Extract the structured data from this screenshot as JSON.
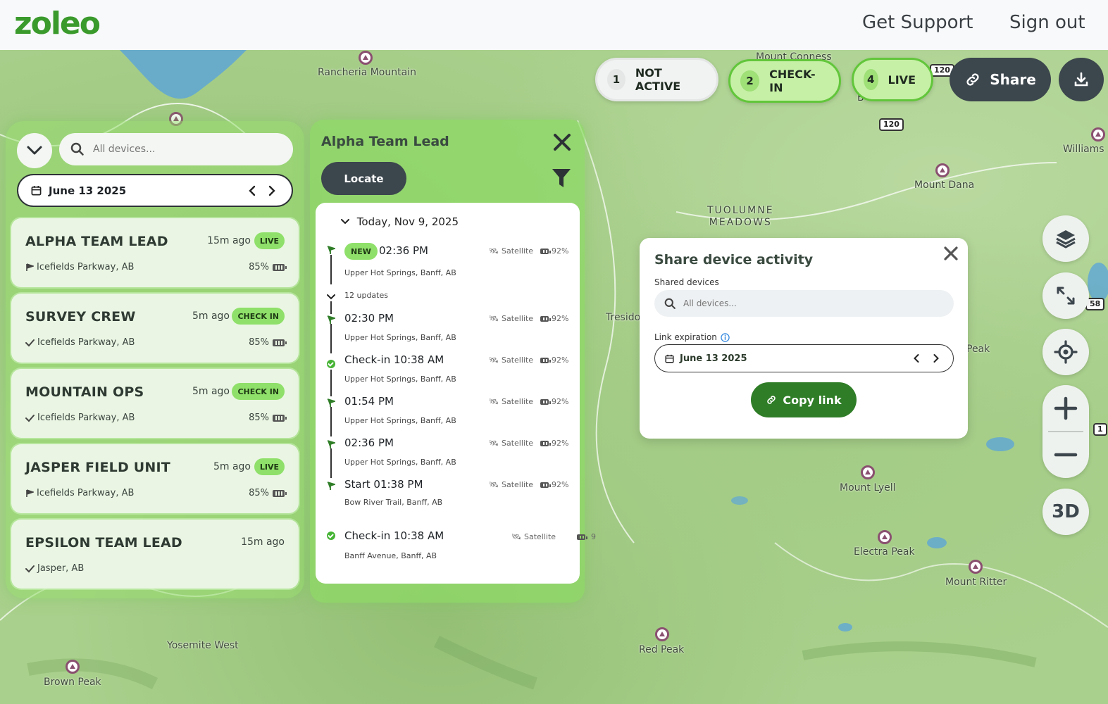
{
  "header": {
    "logo": "zoleo",
    "links": [
      "Get Support",
      "Sign out"
    ]
  },
  "status_pills": [
    {
      "count": "1",
      "label": "NOT ACTIVE",
      "variant": "inactive"
    },
    {
      "count": "2",
      "label": "CHECK-IN",
      "variant": "green"
    },
    {
      "count": "4",
      "label": "LIVE",
      "variant": "green"
    }
  ],
  "share_label": "Share",
  "sidebar": {
    "search_placeholder": "All devices...",
    "date": "June 13 2025",
    "devices": [
      {
        "name": "ALPHA TEAM LEAD",
        "ago": "15m ago",
        "badge": "LIVE",
        "location": "Icefields Parkway, AB",
        "battery": "85%",
        "loc_icon": "flag"
      },
      {
        "name": "SURVEY CREW",
        "ago": "5m ago",
        "badge": "CHECK IN",
        "location": "Icefields Parkway, AB",
        "battery": "85%",
        "loc_icon": "check"
      },
      {
        "name": "MOUNTAIN OPS",
        "ago": "5m ago",
        "badge": "CHECK IN",
        "location": "Icefields Parkway, AB",
        "battery": "85%",
        "loc_icon": "check"
      },
      {
        "name": "JASPER FIELD UNIT",
        "ago": "5m ago",
        "badge": "LIVE",
        "location": "Icefields Parkway, AB",
        "battery": "85%",
        "loc_icon": "flag"
      },
      {
        "name": "EPSILON TEAM LEAD",
        "ago": "15m ago",
        "badge": "",
        "location": "Jasper, AB",
        "battery": "",
        "loc_icon": "check"
      }
    ]
  },
  "detail": {
    "title": "Alpha Team Lead",
    "locate_label": "Locate",
    "date_header": "Today, Nov 9, 2025",
    "new_badge": "NEW",
    "updates_label": "12 updates",
    "entries": [
      {
        "time": "02:36 PM",
        "address": "Upper Hot Springs, Banff, AB",
        "signal": "Satellite",
        "battery": "92%",
        "icon": "flag"
      },
      {
        "time": "02:30 PM",
        "address": "Upper Hot Springs, Banff, AB",
        "signal": "Satellite",
        "battery": "92%",
        "icon": "flag"
      },
      {
        "time": "Check-in 10:38 AM",
        "address": "Upper Hot Springs, Banff, AB",
        "signal": "Satellite",
        "battery": "92%",
        "icon": "check"
      },
      {
        "time": "01:54 PM",
        "address": "Upper Hot Springs, Banff, AB",
        "signal": "Satellite",
        "battery": "92%",
        "icon": "flag"
      },
      {
        "time": "02:36 PM",
        "address": "Upper Hot Springs, Banff, AB",
        "signal": "Satellite",
        "battery": "92%",
        "icon": "flag"
      },
      {
        "time": "Start 01:38 PM",
        "address": "Bow River Trail, Banff, AB",
        "signal": "Satellite",
        "battery": "92%",
        "icon": "flag"
      },
      {
        "time": "Check-in 10:38 AM",
        "address": "Banff Avenue, Banff, AB",
        "signal": "Satellite",
        "battery": "9",
        "icon": "check"
      }
    ]
  },
  "share_dialog": {
    "title": "Share device activity",
    "shared_devices_label": "Shared devices",
    "search_placeholder": "All devices...",
    "expiration_label": "Link expiration",
    "date": "June 13 2025",
    "copy_label": "Copy link"
  },
  "map_controls": {
    "three_d": "3D"
  },
  "map_labels": {
    "rancheria": "Rancheria Mountain",
    "tuolumne": "TUOLUMNE\nMEADOWS",
    "mount_dana": "Mount Dana",
    "williams": "Williams",
    "mount_conness": "Mount Conness",
    "peak": "Peak",
    "tresid": "Tresido",
    "mount_lyell": "Mount Lyell",
    "electra": "Electra Peak",
    "ritter": "Mount Ritter",
    "red_peak": "Red Peak",
    "yosemite_west": "Yosemite West",
    "brown_peak": "Brown Peak",
    "route_120a": "120",
    "route_120b": "120",
    "route_58": "58",
    "route_1": "1",
    "b_label": "B"
  },
  "colors": {
    "accent_green": "#62c63b",
    "dark_button": "#3c464d",
    "copy_green": "#2f7d27",
    "badge_green": "#8fe06a"
  }
}
